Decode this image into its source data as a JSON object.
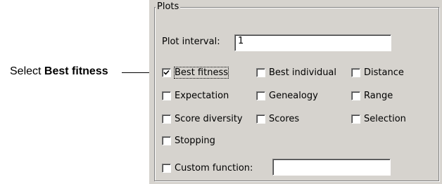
{
  "callout": {
    "prefix": "Select",
    "bold": "Best fitness"
  },
  "plots": {
    "title": "Plots",
    "interval_label": "Plot interval:",
    "interval_value": "1",
    "checkboxes": [
      {
        "label": "Best fitness",
        "checked": true
      },
      {
        "label": "Best individual",
        "checked": false
      },
      {
        "label": "Distance",
        "checked": false
      },
      {
        "label": "Expectation",
        "checked": false
      },
      {
        "label": "Genealogy",
        "checked": false
      },
      {
        "label": "Range",
        "checked": false
      },
      {
        "label": "Score diversity",
        "checked": false
      },
      {
        "label": "Scores",
        "checked": false
      },
      {
        "label": "Selection",
        "checked": false
      },
      {
        "label": "Stopping",
        "checked": false
      }
    ],
    "custom_label": "Custom function:",
    "custom_value": ""
  }
}
